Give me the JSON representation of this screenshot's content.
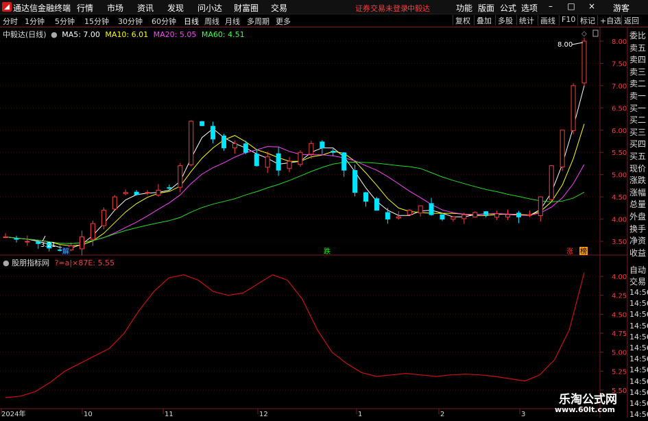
{
  "app": {
    "title": "通达信金融终端"
  },
  "menu": [
    "行情",
    "市场",
    "资讯",
    "发现",
    "问小达",
    "财富圈",
    "交易"
  ],
  "status_text": "证券交易未登录",
  "status_broker": "中毅达",
  "top_right": [
    "功能",
    "版面",
    "公式",
    "选项"
  ],
  "guest": "游客",
  "nav": {
    "periods": [
      "分时",
      "1分钟",
      "5分钟",
      "15分钟",
      "30分钟",
      "60分钟",
      "日线",
      "周线",
      "月线",
      "多周期",
      "更多"
    ],
    "active": "日线",
    "right_buttons": [
      "复权",
      "叠加",
      "多股",
      "统计",
      "画线",
      "F10",
      "标记",
      "+自选",
      "返回"
    ]
  },
  "chart_info": {
    "name": "中毅达(日线)",
    "ma5": "MA5: 7.00",
    "ma10": "MA10: 6.01",
    "ma20": "MA20: 5.05",
    "ma60": "MA60: 4.51"
  },
  "sub_info": {
    "name": "股朋指标网",
    "formula": "?=a|×87E: 5.55"
  },
  "price_axis": [
    "8.00",
    "7.50",
    "7.00",
    "6.50",
    "6.00",
    "5.50",
    "5.00",
    "4.50",
    "4.00",
    "3.50"
  ],
  "sub_axis": [
    "5.50",
    "5.25",
    "5.00",
    "4.75",
    "4.50",
    "4.25",
    "4.00"
  ],
  "annotations": {
    "high": "8.00",
    "low": "3.21"
  },
  "markers": {
    "jie": "解",
    "die": "跌",
    "zhang": "涨",
    "bang": "榜"
  },
  "date_axis": [
    "2024年",
    "10",
    "11",
    "12",
    "1",
    "2",
    "3"
  ],
  "sidebar": [
    "委比",
    "卖五",
    "卖四",
    "卖三",
    "卖二",
    "卖一",
    "买一",
    "买二",
    "买三",
    "买四",
    "买五",
    "现价",
    "涨跌",
    "涨幅",
    "总量",
    "外盘",
    "换手",
    "净资",
    "收益"
  ],
  "sidebar_lower": [
    "自动",
    "交易"
  ],
  "time_list": [
    "14:56",
    "14:56",
    "14:56",
    "14:56",
    "14:56",
    "14:56",
    "14:56",
    "14:56",
    "14:56",
    "14:56",
    "14:56",
    "14:56"
  ],
  "watermark": {
    "line1": "乐淘公式网",
    "line2": "www.60lt.com"
  },
  "colors": {
    "up": "#ff3c3c",
    "down": "#00ffff",
    "ma5": "#ffffff",
    "ma10": "#ffff00",
    "ma20": "#ff00ff",
    "ma60": "#00ff00",
    "indicator": "#cc1111",
    "border": "#7a1d1d"
  },
  "chart_data": [
    {
      "type": "candlestick",
      "title": "中毅达(日线)",
      "ylim": [
        3.21,
        8.0
      ],
      "x_labels": [
        "2024年",
        "10",
        "11",
        "12",
        "1",
        "2",
        "3"
      ],
      "close_trend": [
        3.6,
        3.55,
        3.5,
        3.45,
        3.35,
        3.3,
        3.4,
        3.6,
        3.9,
        4.2,
        4.5,
        4.6,
        4.55,
        4.6,
        4.65,
        4.7,
        5.2,
        6.2,
        6.1,
        5.8,
        5.6,
        5.7,
        5.5,
        5.2,
        5.4,
        5.1,
        5.3,
        5.5,
        5.7,
        5.6,
        5.5,
        5.1,
        4.6,
        4.4,
        4.2,
        4.0,
        4.05,
        4.2,
        4.3,
        4.1,
        4.0,
        4.05,
        4.1,
        4.15,
        4.1,
        4.12,
        4.1,
        4.05,
        4.1,
        4.5,
        5.2,
        6.0,
        7.0,
        8.0
      ],
      "ma_values": {
        "MA5": 7.0,
        "MA10": 6.01,
        "MA20": 5.05,
        "MA60": 4.51
      }
    },
    {
      "type": "line",
      "title": "股朋指标网",
      "ylim": [
        3.9,
        5.6
      ],
      "y_ticks": [
        4.0,
        4.25,
        4.5,
        4.75,
        5.0,
        5.25,
        5.5
      ],
      "values": [
        3.9,
        3.92,
        3.98,
        4.1,
        4.25,
        4.35,
        4.45,
        4.55,
        4.75,
        5.05,
        5.3,
        5.48,
        5.52,
        5.45,
        5.3,
        5.25,
        5.28,
        5.4,
        5.52,
        5.45,
        5.2,
        4.8,
        4.5,
        4.35,
        4.23,
        4.18,
        4.2,
        4.22,
        4.2,
        4.18,
        4.2,
        4.21,
        4.2,
        4.18,
        4.15,
        4.12,
        4.2,
        4.4,
        4.8,
        5.55
      ],
      "last_value": 5.55
    }
  ]
}
